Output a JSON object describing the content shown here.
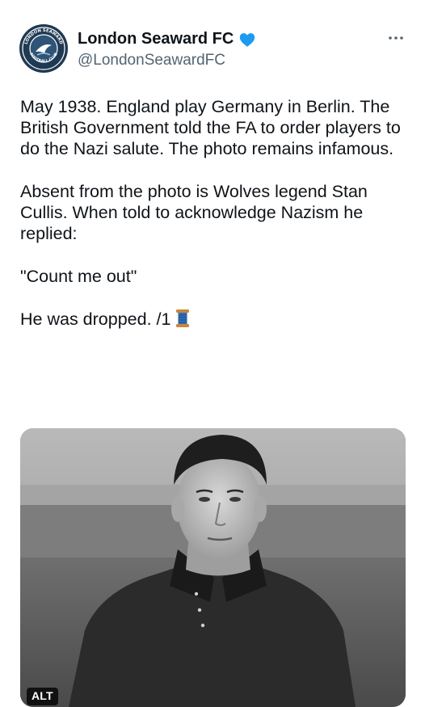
{
  "account": {
    "display_name": "London Seaward FC",
    "handle": "@LondonSeawardFC",
    "verified": true,
    "avatar_text_top": "LONDON SEAWARD",
    "avatar_text_bottom": "FOOTBALL CLUB"
  },
  "tweet": {
    "paragraphs": [
      "May 1938. England play Germany in Berlin. The British Government told the FA to order players to do the Nazi salute. The photo remains infamous.",
      "Absent from the photo is Wolves legend Stan Cullis. When told to acknowledge Nazism he replied:",
      "\"Count me out\"",
      "He was dropped. /1"
    ],
    "thread_icon": "spool-of-thread-icon"
  },
  "media": {
    "alt_badge": "ALT",
    "type": "black-and-white-photo"
  },
  "colors": {
    "text": "#0f1419",
    "secondary": "#536471",
    "verified": "#1d9bf0",
    "avatar_bg": "#1f3a52"
  }
}
